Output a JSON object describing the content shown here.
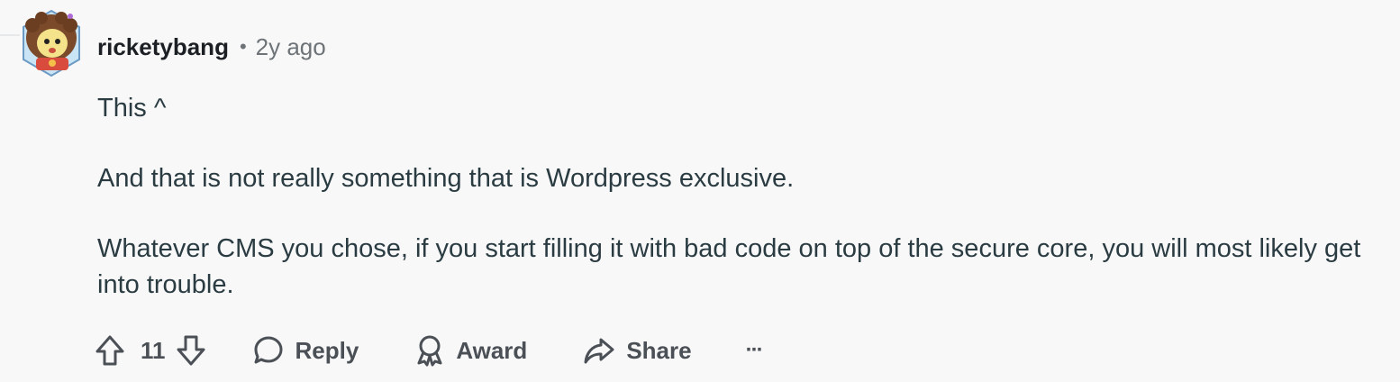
{
  "comment": {
    "author": "ricketybang",
    "separator": "•",
    "time": "2y ago",
    "paragraphs": [
      "This ^",
      "And that is not really something that is Wordpress exclusive.",
      "Whatever CMS you chose, if you start filling it with bad code on top of the secure core, you will most likely get into trouble."
    ],
    "avatar_icon": "user-avatar-cartoon"
  },
  "actions": {
    "score": "11",
    "upvote_icon": "arrow-up-icon",
    "downvote_icon": "arrow-down-icon",
    "reply_label": "Reply",
    "award_label": "Award",
    "share_label": "Share",
    "more_label": "···"
  },
  "colors": {
    "background": "#f8f8f9",
    "text": "#1c1f23",
    "secondary": "#6e7378",
    "action": "#4b5056"
  }
}
